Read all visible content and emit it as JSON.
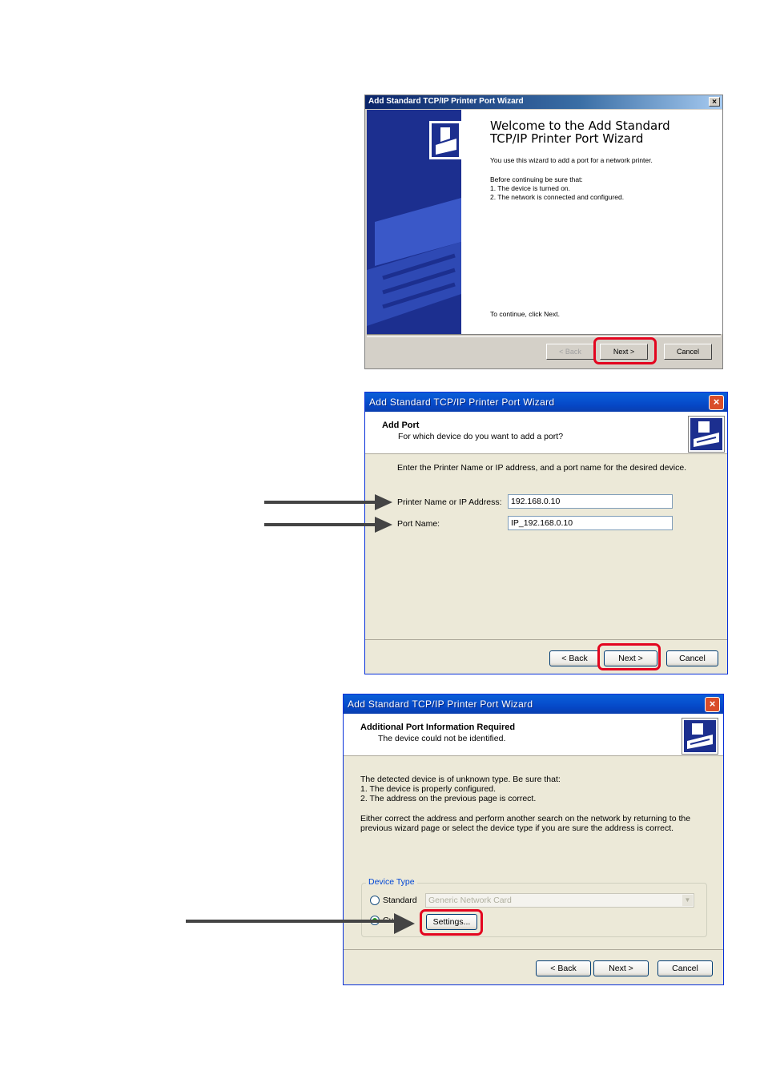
{
  "dialog1": {
    "title": "Add Standard TCP/IP Printer Port Wizard",
    "close": "×",
    "welcome_line1": "Welcome to the Add Standard",
    "welcome_line2": "TCP/IP Printer Port Wizard",
    "intro": "You use this wizard to add a port for a network printer.",
    "before": "Before continuing be sure that:",
    "item1": "1.  The device is turned on.",
    "item2": "2.  The network is connected and configured.",
    "continue": "To continue, click Next.",
    "back_label": "< Back",
    "next_label": "Next >",
    "cancel_label": "Cancel"
  },
  "dialog2": {
    "title": "Add Standard TCP/IP Printer Port Wizard",
    "close": "×",
    "header_title": "Add Port",
    "header_sub": "For which device do you want to add a port?",
    "instruction": "Enter the Printer Name or IP address, and a port name for the desired device.",
    "printer_label": "Printer Name or IP Address:",
    "printer_value": "192.168.0.10",
    "port_label": "Port Name:",
    "port_value": "IP_192.168.0.10",
    "back_label": "< Back",
    "next_label": "Next >",
    "cancel_label": "Cancel"
  },
  "dialog3": {
    "title": "Add Standard TCP/IP Printer Port Wizard",
    "close": "×",
    "header_title": "Additional Port Information Required",
    "header_sub": "The device could not be identified.",
    "p1": "The detected device is of unknown type.  Be sure that:",
    "p2": "1. The device is properly configured.",
    "p3": "2.  The address on the previous page is correct.",
    "p4": "Either correct the address and perform another search on the network by returning to the",
    "p5": "previous wizard page or select the device type if you are sure the address is correct.",
    "group_label": "Device Type",
    "standard_label": "Standard",
    "standard_select": "Generic Network Card",
    "custom_label": "Cu",
    "settings_label": "Settings...",
    "back_label": "< Back",
    "next_label": "Next >",
    "cancel_label": "Cancel"
  },
  "colors": {
    "highlight": "#e3051f",
    "arrow": "#444444",
    "xp_title": "#0751d0",
    "xp_face": "#ece9d8"
  }
}
